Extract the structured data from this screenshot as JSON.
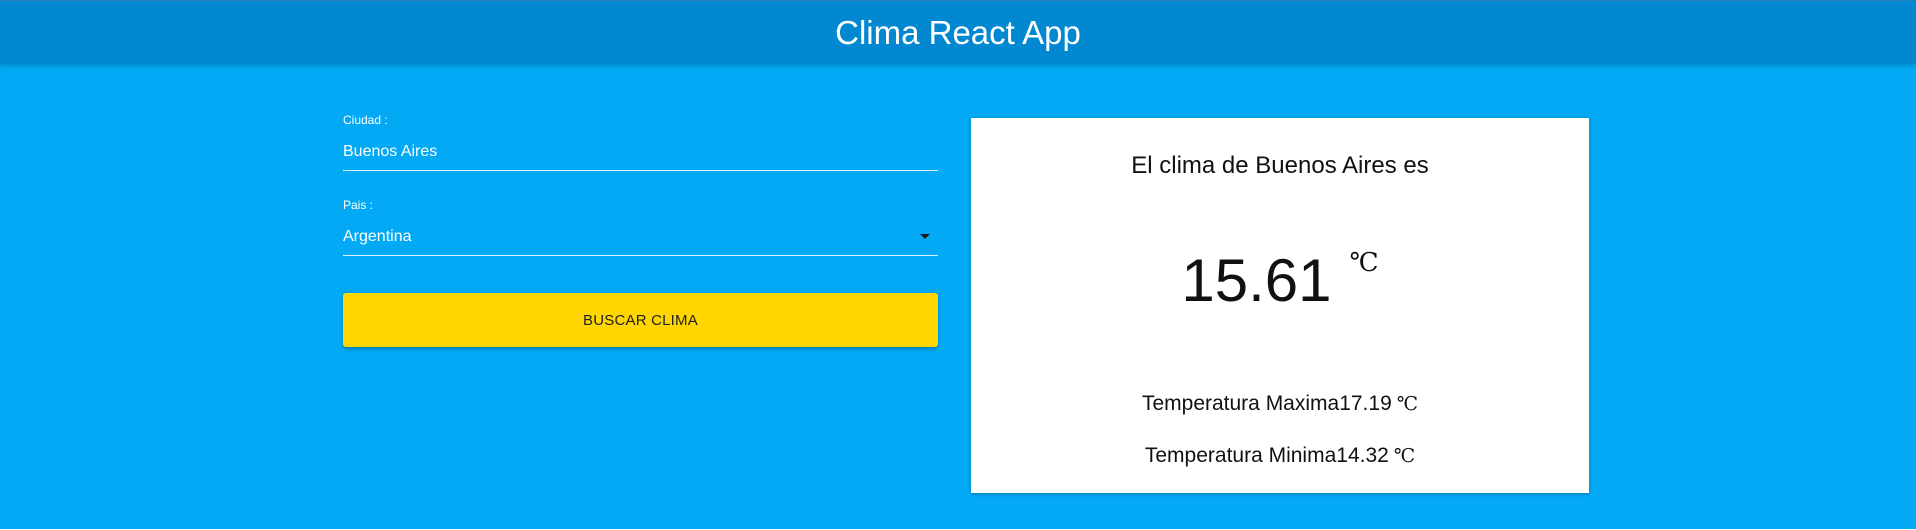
{
  "header": {
    "title": "Clima React App"
  },
  "form": {
    "city": {
      "label": "Ciudad :",
      "value": "Buenos Aires"
    },
    "country": {
      "label": "Pais :",
      "selected": "Argentina"
    },
    "search_label": "BUSCAR CLIMA"
  },
  "result": {
    "heading": "El clima de Buenos Aires es",
    "temperature": "15.61",
    "unit": "℃",
    "max_label": "Temperatura Maxima",
    "max_value": "17.19",
    "min_label": "Temperatura Minima",
    "min_value": "14.32"
  },
  "colors": {
    "app_background": "#03a9f4",
    "header_background": "#0288d1",
    "button_background": "#ffd600",
    "card_background": "#ffffff"
  },
  "icons": {
    "select_caret": "caret-down-icon"
  }
}
